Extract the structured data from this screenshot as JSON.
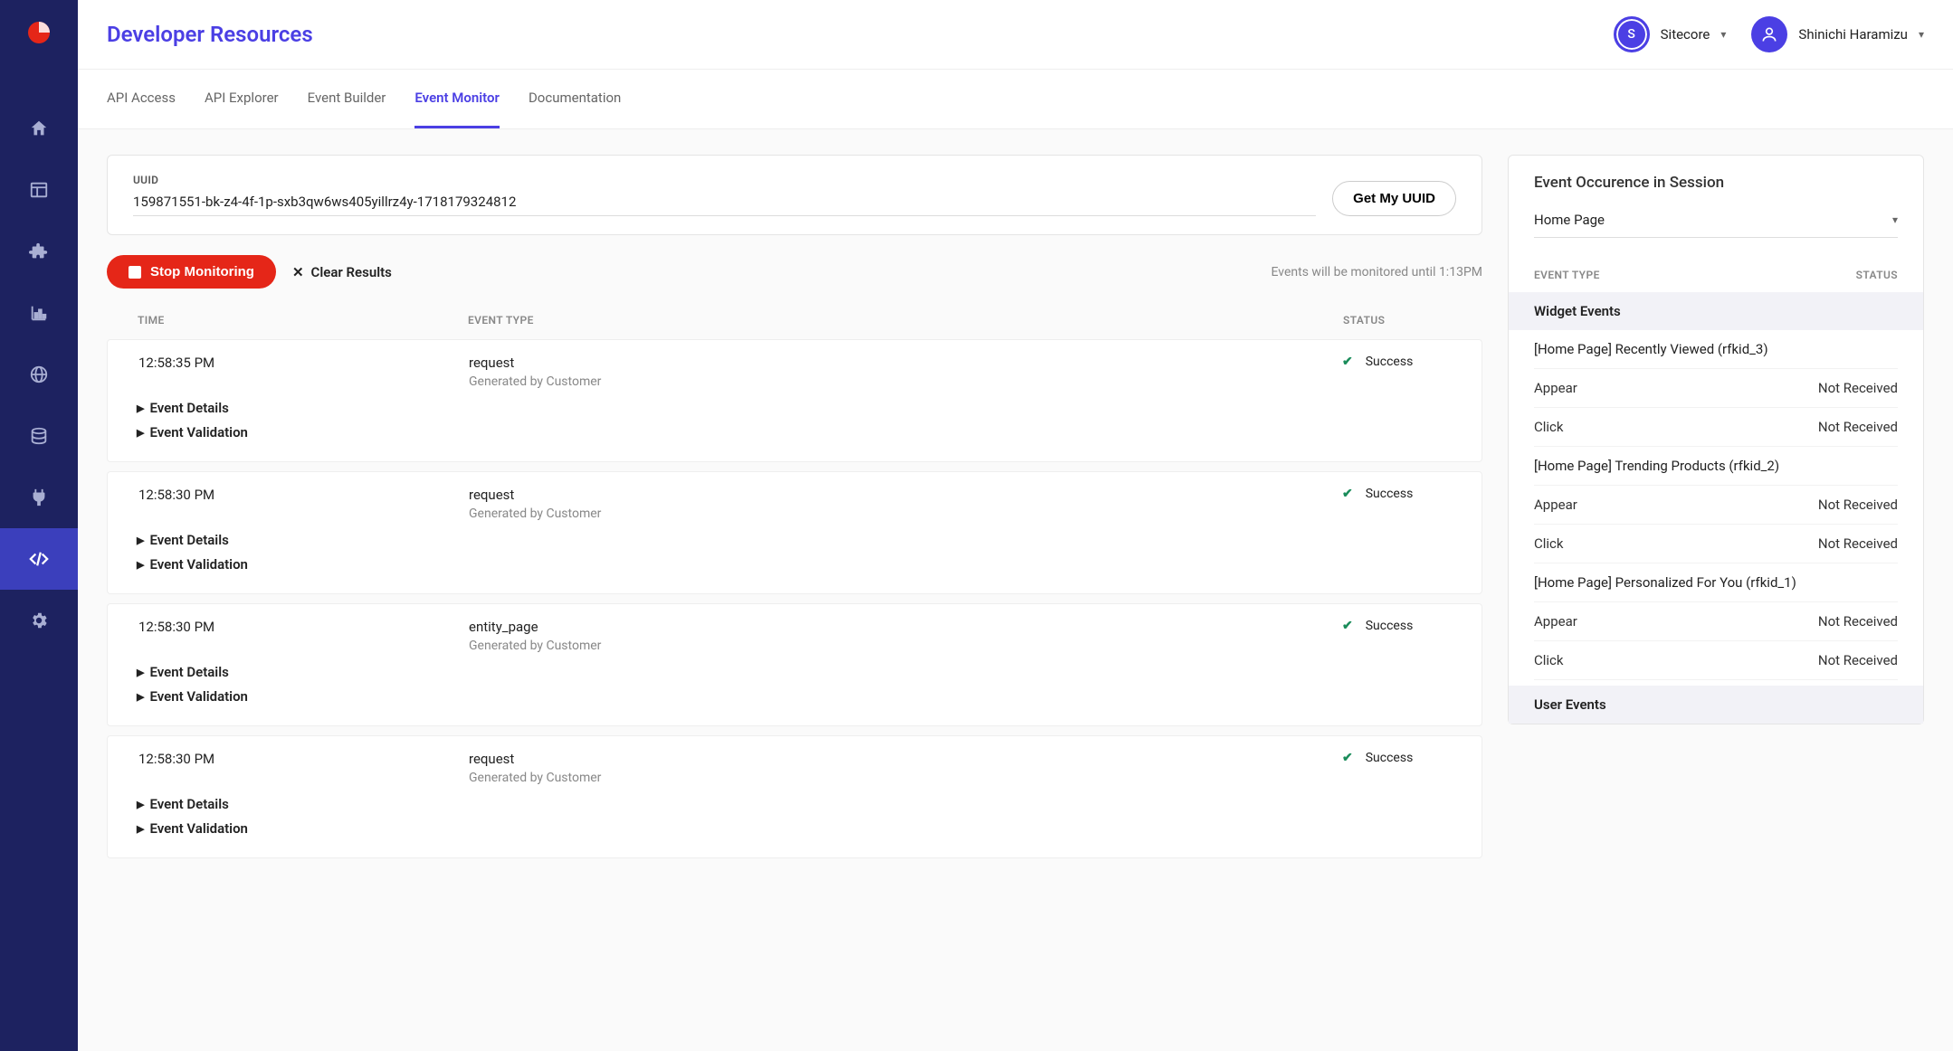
{
  "header": {
    "title": "Developer Resources",
    "org": {
      "initial": "S",
      "name": "Sitecore"
    },
    "user": {
      "name": "Shinichi Haramizu"
    }
  },
  "tabs": [
    {
      "label": "API Access",
      "active": false
    },
    {
      "label": "API Explorer",
      "active": false
    },
    {
      "label": "Event Builder",
      "active": false
    },
    {
      "label": "Event Monitor",
      "active": true
    },
    {
      "label": "Documentation",
      "active": false
    }
  ],
  "uuid": {
    "label": "UUID",
    "value": "159871551-bk-z4-4f-1p-sxb3qw6ws405yillrz4y-1718179324812",
    "button": "Get My UUID"
  },
  "actions": {
    "stop": "Stop Monitoring",
    "clear": "Clear Results",
    "note": "Events will be monitored until 1:13PM"
  },
  "table": {
    "cols": {
      "time": "TIME",
      "type": "EVENT TYPE",
      "status": "STATUS"
    },
    "detailsLabel": "Event Details",
    "validationLabel": "Event Validation",
    "rows": [
      {
        "time": "12:58:35 PM",
        "type": "request",
        "sub": "Generated by Customer",
        "status": "Success"
      },
      {
        "time": "12:58:30 PM",
        "type": "request",
        "sub": "Generated by Customer",
        "status": "Success"
      },
      {
        "time": "12:58:30 PM",
        "type": "entity_page",
        "sub": "Generated by Customer",
        "status": "Success"
      },
      {
        "time": "12:58:30 PM",
        "type": "request",
        "sub": "Generated by Customer",
        "status": "Success"
      }
    ]
  },
  "side": {
    "title": "Event Occurence in Session",
    "page": "Home Page",
    "cols": {
      "type": "EVENT TYPE",
      "status": "STATUS"
    },
    "widgetHeader": "Widget Events",
    "userHeader": "User Events",
    "widgets": [
      {
        "name": "[Home Page] Recently Viewed (rfkid_3)",
        "rows": [
          {
            "k": "Appear",
            "v": "Not Received"
          },
          {
            "k": "Click",
            "v": "Not Received"
          }
        ]
      },
      {
        "name": "[Home Page] Trending Products (rfkid_2)",
        "rows": [
          {
            "k": "Appear",
            "v": "Not Received"
          },
          {
            "k": "Click",
            "v": "Not Received"
          }
        ]
      },
      {
        "name": "[Home Page] Personalized For You (rfkid_1)",
        "rows": [
          {
            "k": "Appear",
            "v": "Not Received"
          },
          {
            "k": "Click",
            "v": "Not Received"
          }
        ]
      }
    ]
  }
}
